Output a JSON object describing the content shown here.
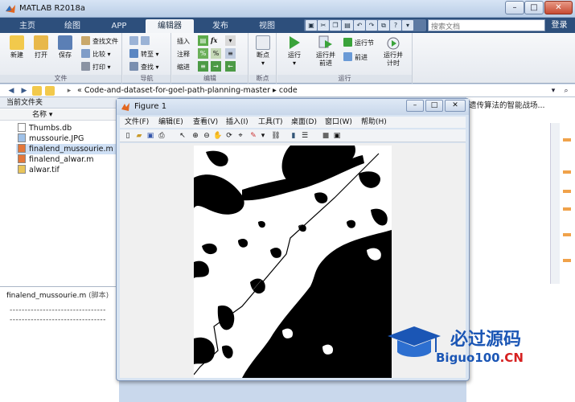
{
  "window": {
    "title": "MATLAB R2018a",
    "min": "–",
    "max": "□",
    "close": "✕"
  },
  "tabs": [
    "主页",
    "绘图",
    "APP",
    "编辑器",
    "发布",
    "视图"
  ],
  "active_tab": "编辑器",
  "search": {
    "placeholder": "搜索文档"
  },
  "login": "登录",
  "ribbon": {
    "file": {
      "label": "文件",
      "new": "新建",
      "open": "打开",
      "save": "保存",
      "find_files": "查找文件",
      "compare": "比较",
      "print": "打印"
    },
    "navigate": {
      "label": "导航",
      "goto": "转至",
      "find": "查找"
    },
    "edit": {
      "label": "编辑",
      "insert": "插入",
      "comment": "注释",
      "indent": "缩进"
    },
    "breakpoints": {
      "label": "断点",
      "breakpoints": "断点"
    },
    "run": {
      "label": "运行",
      "run": "运行",
      "run_advance_1": "运行并",
      "run_advance_2": "前进",
      "run_section": "运行节",
      "advance": "前进",
      "run_time_1": "运行并",
      "run_time_2": "计时"
    }
  },
  "address": {
    "path": "« Code-and-dataset-for-goel-path-planning-master ▸ code"
  },
  "file_panel": {
    "title": "当前文件夹",
    "column": "名称 ▾",
    "files": [
      "Thumbs.db",
      "mussourie.JPG",
      "finalend_mussourie.m",
      "finalend_alwar.m",
      "alwar.tif"
    ],
    "selected_index": 2
  },
  "detail_panel": {
    "file": "finalend_mussourie.m",
    "kind": "(脚本)",
    "line1": "--------------------------------",
    "line2": "--------------------------------"
  },
  "editor_tab_text": "遗传算法的智能战场...",
  "figure": {
    "title": "Figure 1",
    "menus": [
      "文件(F)",
      "编辑(E)",
      "查看(V)",
      "插入(I)",
      "工具(T)",
      "桌面(D)",
      "窗口(W)",
      "帮助(H)"
    ]
  },
  "watermark": {
    "cn": "必过源码",
    "en_main": "Biguo100",
    "en_suffix": ".CN"
  }
}
